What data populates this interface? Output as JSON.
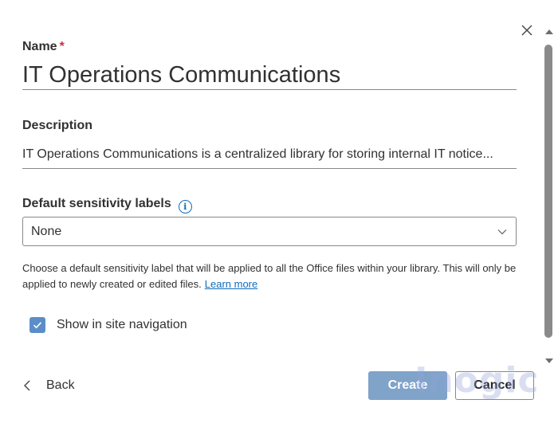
{
  "dialog": {
    "close_icon": "close-icon"
  },
  "name_field": {
    "label": "Name",
    "required_mark": "*",
    "value": "IT Operations Communications"
  },
  "description_field": {
    "label": "Description",
    "value": "IT Operations Communications is a centralized library for storing internal IT notice..."
  },
  "sensitivity": {
    "label": "Default sensitivity labels",
    "info_icon": "info-icon",
    "selected_value": "None",
    "help_text": "Choose a default sensitivity label that will be applied to all the Office files within your library. This will only be applied to newly created or edited files.",
    "learn_more": "Learn more"
  },
  "navigation": {
    "checkbox_label": "Show in site navigation",
    "checked": true
  },
  "footer": {
    "back_label": "Back",
    "create_label": "Create",
    "cancel_label": "Cancel"
  },
  "watermark": "Inogic",
  "colors": {
    "accent": "#0f6cbd",
    "create_button": "#7fa3c9",
    "checkbox": "#5b8ec9",
    "required": "#c4314b"
  }
}
